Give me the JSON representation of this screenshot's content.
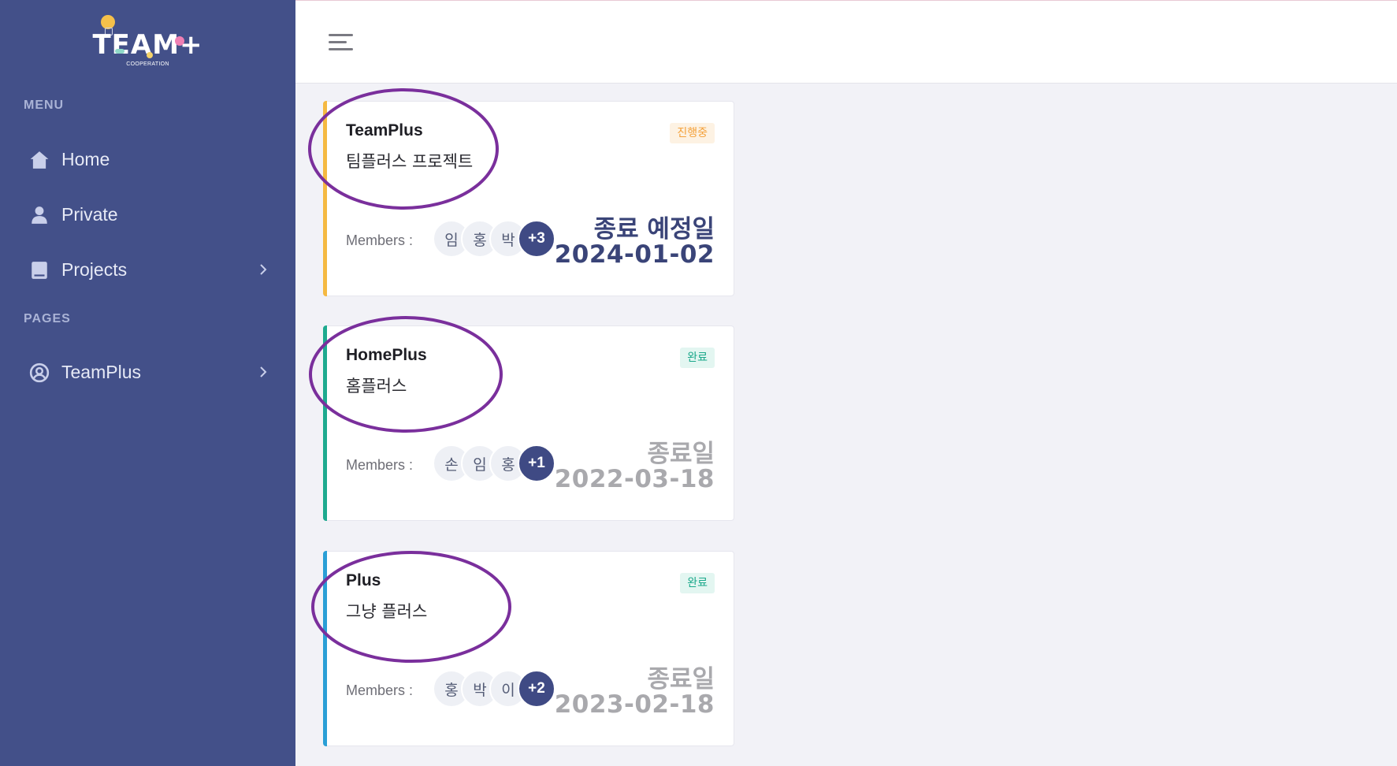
{
  "logo": {
    "text": "TEAM+",
    "subtitle": "COOPERATION"
  },
  "sidebar": {
    "sections": [
      {
        "label": "MENU"
      },
      {
        "label": "PAGES"
      }
    ],
    "items": [
      {
        "label": "Home",
        "icon": "home-icon"
      },
      {
        "label": "Private",
        "icon": "user-icon"
      },
      {
        "label": "Projects",
        "icon": "book-icon",
        "has_submenu": true
      },
      {
        "label": "TeamPlus",
        "icon": "user-circle-icon",
        "has_submenu": true
      }
    ],
    "colors": {
      "background": "#435089",
      "text": "#e7eaf6",
      "section": "#aab3d6"
    }
  },
  "topbar": {
    "menu_icon": "hamburger-icon"
  },
  "projects": [
    {
      "title": "TeamPlus",
      "description": "팀플러스 프로젝트",
      "status": "진행중",
      "status_color": "#f4a13a",
      "status_bg": "#fdf2e3",
      "accent_color": "#f5b942",
      "members_label": "Members :",
      "members": [
        "임",
        "홍",
        "박"
      ],
      "more": "+3",
      "due_label": "종료 예정일",
      "due_date": "2024-01-02",
      "due_color": "#3a4478"
    },
    {
      "title": "HomePlus",
      "description": "홈플러스",
      "status": "완료",
      "status_color": "#1aa88a",
      "status_bg": "#e3f6f1",
      "accent_color": "#1eaa8f",
      "members_label": "Members :",
      "members": [
        "손",
        "임",
        "홍"
      ],
      "more": "+1",
      "due_label": "종료일",
      "due_date": "2022-03-18",
      "due_color": "#a9a9ad"
    },
    {
      "title": "Plus",
      "description": "그냥 플러스",
      "status": "완료",
      "status_color": "#1aa88a",
      "status_bg": "#e3f6f1",
      "accent_color": "#2a9fd6",
      "members_label": "Members :",
      "members": [
        "홍",
        "박",
        "이"
      ],
      "more": "+2",
      "due_label": "종료일",
      "due_date": "2023-02-18",
      "due_color": "#a9a9ad"
    }
  ],
  "annotation_color": "#7a2f9c"
}
